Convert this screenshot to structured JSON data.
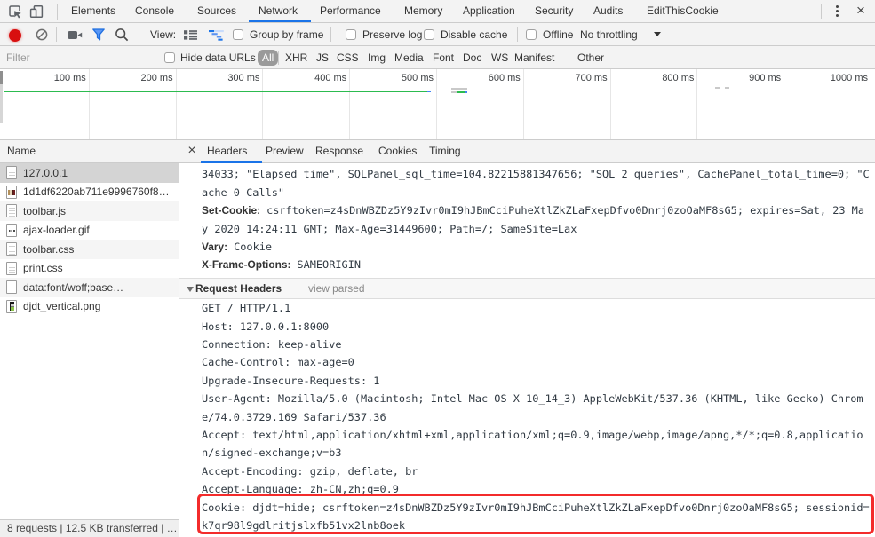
{
  "top_bar": {
    "tabs": [
      {
        "label": "Elements",
        "selected": false
      },
      {
        "label": "Console",
        "selected": false
      },
      {
        "label": "Sources",
        "selected": false
      },
      {
        "label": "Network",
        "selected": true
      },
      {
        "label": "Performance",
        "selected": false
      },
      {
        "label": "Memory",
        "selected": false
      },
      {
        "label": "Application",
        "selected": false
      },
      {
        "label": "Security",
        "selected": false
      },
      {
        "label": "Audits",
        "selected": false
      },
      {
        "label": "EditThisCookie",
        "selected": false
      }
    ],
    "kebab": "⋮",
    "close": "×"
  },
  "toolbar": {
    "view_label": "View:",
    "group_by_frame": {
      "label": "Group by frame",
      "checked": false
    },
    "preserve_log": {
      "label": "Preserve log",
      "checked": false
    },
    "disable_cache": {
      "label": "Disable cache",
      "checked": false
    },
    "offline": {
      "label": "Offline",
      "checked": false
    },
    "throttling": "No throttling"
  },
  "filter_bar": {
    "placeholder": "Filter",
    "hide_data_urls_label": "Hide data URLs",
    "selected_type": "All",
    "types": [
      "XHR",
      "JS",
      "CSS",
      "Img",
      "Media",
      "Font",
      "Doc",
      "WS",
      "Manifest",
      "Other"
    ]
  },
  "timeline": {
    "ticks": [
      "100 ms",
      "200 ms",
      "300 ms",
      "400 ms",
      "500 ms",
      "600 ms",
      "700 ms",
      "800 ms",
      "900 ms",
      "1000 ms"
    ],
    "overview_marks": [
      {
        "kind": "loading-bar",
        "from_ms": 2,
        "to_ms": 489,
        "color": "#2cbb4f",
        "tip_color": "#4285f4"
      },
      {
        "kind": "request-bar",
        "from_ms": 519,
        "to_ms": 537,
        "color": "#c9c9c9"
      },
      {
        "kind": "request-bar",
        "from_ms": 518,
        "to_ms": 537,
        "colors": [
          "#c9c9c9",
          "#2cbb4f",
          "#4285f4"
        ]
      },
      {
        "kind": "dot",
        "at_ms": 823,
        "color": "#c9c9c9"
      },
      {
        "kind": "dot",
        "at_ms": 834,
        "color": "#c9c9c9"
      }
    ]
  },
  "requests": {
    "column_header": "Name",
    "rows": [
      {
        "name": "127.0.0.1",
        "icon": "document-icon",
        "selected": true
      },
      {
        "name": "1d1df6220ab711e9996760f8…",
        "icon": "image-icon",
        "selected": false
      },
      {
        "name": "toolbar.js",
        "icon": "document-icon",
        "selected": false
      },
      {
        "name": "ajax-loader.gif",
        "icon": "image-dots-icon",
        "selected": false
      },
      {
        "name": "toolbar.css",
        "icon": "document-icon",
        "selected": false
      },
      {
        "name": "print.css",
        "icon": "document-icon",
        "selected": false
      },
      {
        "name": "data:font/woff;base…",
        "icon": "blank-icon",
        "selected": false
      },
      {
        "name": "djdt_vertical.png",
        "icon": "image-dark-icon",
        "selected": false
      }
    ],
    "status": "8 requests | 12.5 KB transferred | …"
  },
  "details": {
    "close": "×",
    "tabs": [
      {
        "label": "Headers",
        "selected": true
      },
      {
        "label": "Preview",
        "selected": false
      },
      {
        "label": "Response",
        "selected": false
      },
      {
        "label": "Cookies",
        "selected": false
      },
      {
        "label": "Timing",
        "selected": false
      }
    ],
    "response_tail_lines": [
      {
        "label": "",
        "text": "34033; \"Elapsed time\", SQLPanel_sql_time=104.82215881347656; \"SQL 2 queries\", CachePanel_total_time=0; \"C"
      },
      {
        "label": "",
        "text": "ache 0 Calls\""
      },
      {
        "label": "Set-Cookie:",
        "text": "csrftoken=z4sDnWBZDz5Y9zIvr0mI9hJBmCciPuheXtlZkZLaFxepDfvo0Dnrj0zoOaMF8sG5; expires=Sat, 23 Ma"
      },
      {
        "label": "",
        "text": "y 2020 14:24:11 GMT; Max-Age=31449600; Path=/; SameSite=Lax"
      },
      {
        "label": "Vary:",
        "text": "Cookie"
      },
      {
        "label": "X-Frame-Options:",
        "text": "SAMEORIGIN"
      }
    ],
    "request_headers_section": {
      "title": "Request Headers",
      "link": "view parsed"
    },
    "request_lines": [
      "GET / HTTP/1.1",
      "Host: 127.0.0.1:8000",
      "Connection: keep-alive",
      "Cache-Control: max-age=0",
      "Upgrade-Insecure-Requests: 1",
      "User-Agent: Mozilla/5.0 (Macintosh; Intel Mac OS X 10_14_3) AppleWebKit/537.36 (KHTML, like Gecko) Chrom",
      "e/74.0.3729.169 Safari/537.36",
      "Accept: text/html,application/xhtml+xml,application/xml;q=0.9,image/webp,image/apng,*/*;q=0.8,applicatio",
      "n/signed-exchange;v=b3",
      "Accept-Encoding: gzip, deflate, br",
      "Accept-Language: zh-CN,zh;q=0.9",
      "Cookie: djdt=hide; csrftoken=z4sDnWBZDz5Y9zIvr0mI9hJBmCciPuheXtlZkZLaFxepDfvo0Dnrj0zoOaMF8sG5; sessionid=",
      "k7qr98l9gdlritjslxfb51vx2lnb8oek"
    ]
  },
  "colors": {
    "accent_blue": "#1a73e8",
    "record_red": "#d80f0f",
    "overview_green": "#2cbb4f",
    "overview_blue": "#4285f4",
    "annotation_red": "#f32b2b",
    "toolbar_bg": "#f3f3f3"
  }
}
